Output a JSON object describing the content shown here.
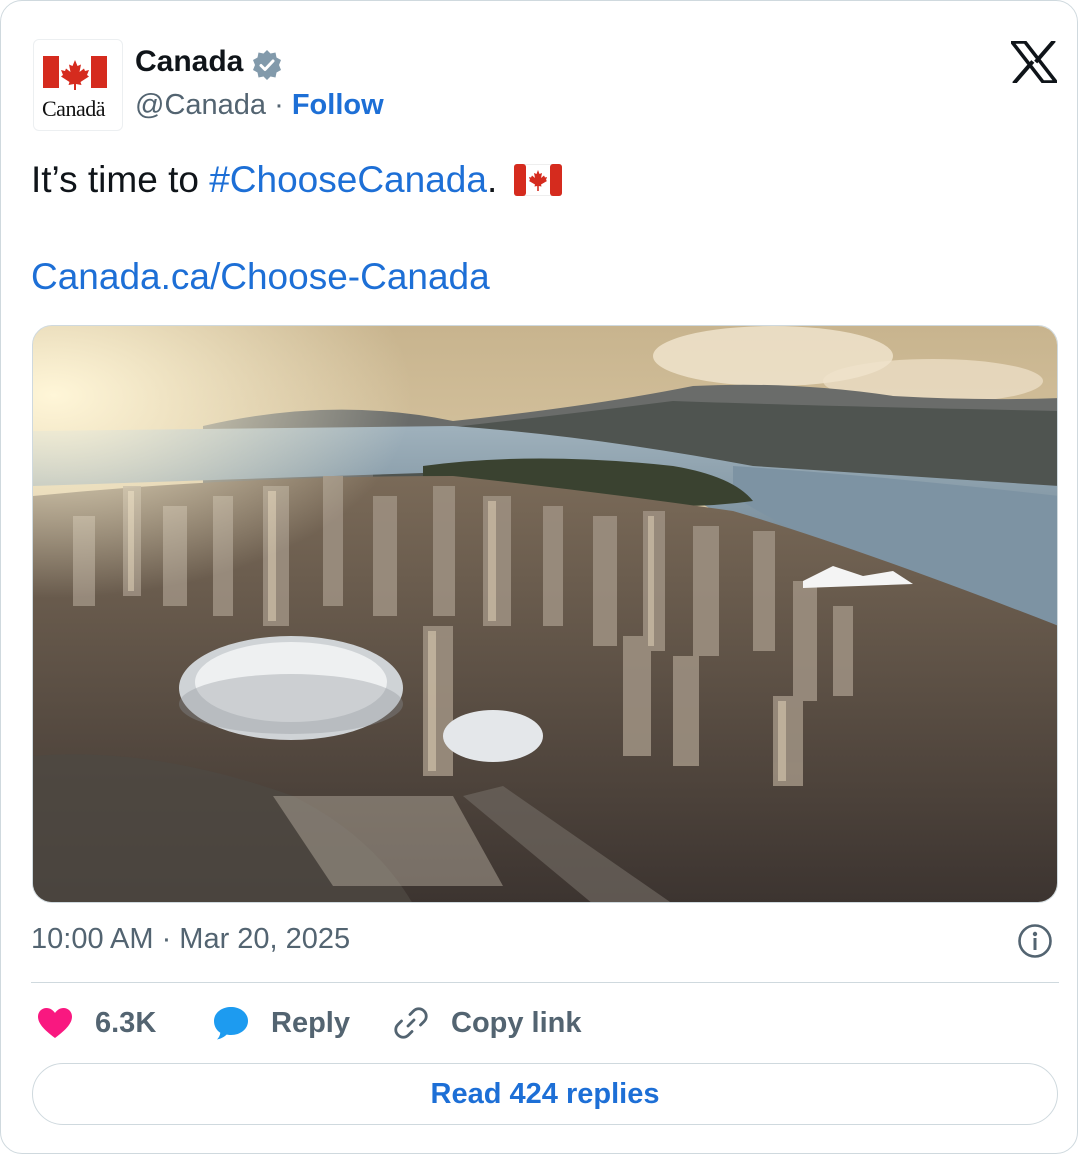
{
  "account": {
    "name": "Canada",
    "handle": "@Canada",
    "separator": "·",
    "follow_label": "Follow",
    "avatar_wordmark": "Canadä",
    "verified": true
  },
  "tweet": {
    "text_prefix": "It’s time to ",
    "hashtag": "#ChooseCanada",
    "text_suffix": ".",
    "link": "Canada.ca/Choose-Canada"
  },
  "meta": {
    "timestamp": "10:00 AM · Mar 20, 2025"
  },
  "actions": {
    "likes": "6.3K",
    "reply_label": "Reply",
    "copy_link_label": "Copy link"
  },
  "replies_button": "Read 424 replies",
  "colors": {
    "accent": "#1d6fd6",
    "like": "#f91880",
    "secondary_text": "#536471",
    "flag_red": "#d52b1e",
    "verified_badge": "#829aab"
  },
  "icons": [
    "verified-badge-icon",
    "x-logo-icon",
    "info-icon",
    "heart-icon",
    "reply-bubble-icon",
    "link-icon"
  ]
}
